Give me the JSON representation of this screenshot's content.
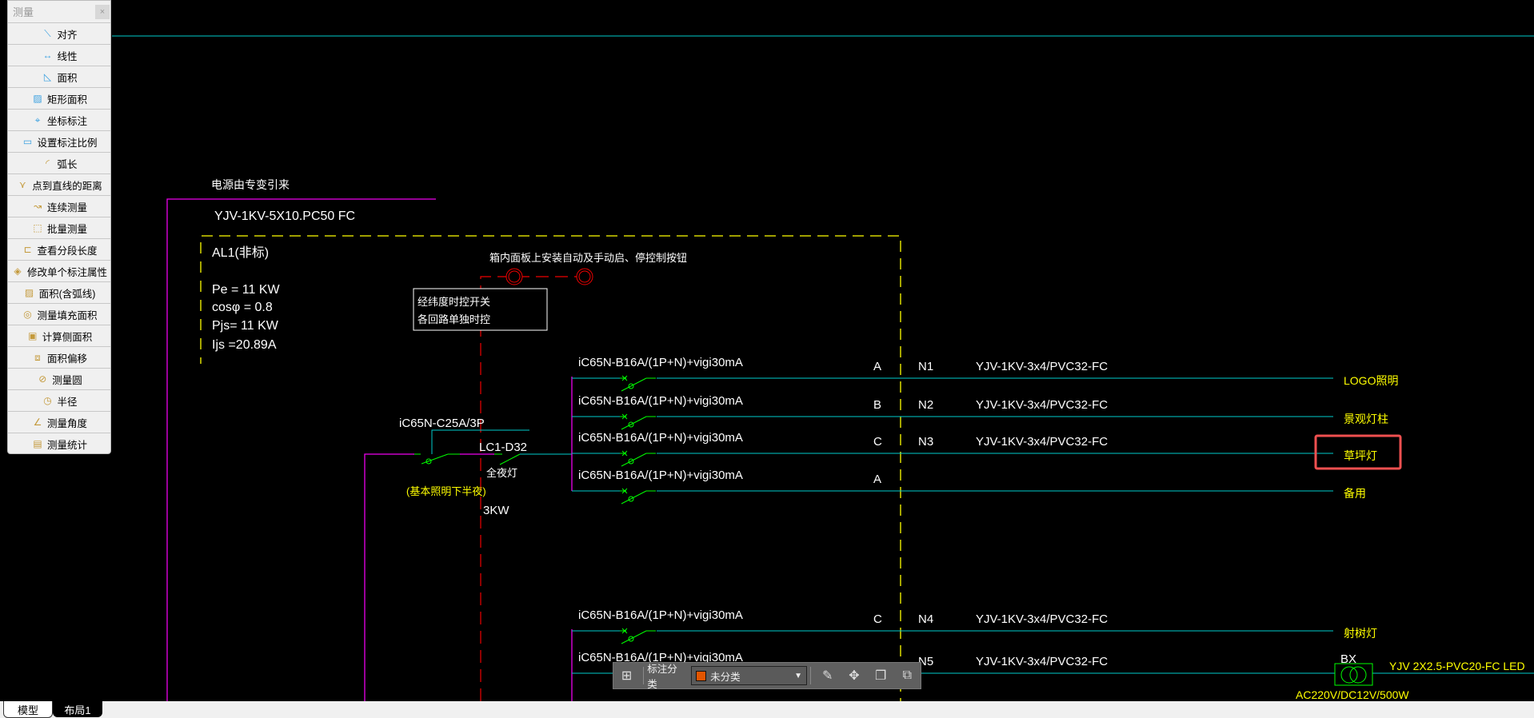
{
  "panel": {
    "title": "测量",
    "close_label": "×",
    "items": [
      {
        "label": "对齐",
        "icon": "aligned-dimension-icon"
      },
      {
        "label": "线性",
        "icon": "linear-dimension-icon"
      },
      {
        "label": "面积",
        "icon": "area-icon"
      },
      {
        "label": "矩形面积",
        "icon": "rect-area-icon"
      },
      {
        "label": "坐标标注",
        "icon": "coordinate-icon"
      },
      {
        "label": "设置标注比例",
        "icon": "scale-ruler-icon"
      },
      {
        "label": "弧长",
        "icon": "arc-length-icon"
      },
      {
        "label": "点到直线的距离",
        "icon": "point-line-distance-icon"
      },
      {
        "label": "连续测量",
        "icon": "continuous-measure-icon"
      },
      {
        "label": "批量测量",
        "icon": "batch-measure-icon"
      },
      {
        "label": "查看分段长度",
        "icon": "segment-length-icon"
      },
      {
        "label": "修改单个标注属性",
        "icon": "edit-dimension-icon"
      },
      {
        "label": "面积(含弧线)",
        "icon": "arc-area-icon"
      },
      {
        "label": "测量填充面积",
        "icon": "hatch-area-icon"
      },
      {
        "label": "计算侧面积",
        "icon": "side-area-icon"
      },
      {
        "label": "面积偏移",
        "icon": "area-offset-icon"
      },
      {
        "label": "测量圆",
        "icon": "circle-measure-icon"
      },
      {
        "label": "半径",
        "icon": "radius-icon"
      },
      {
        "label": "测量角度",
        "icon": "angle-icon"
      },
      {
        "label": "测量统计",
        "icon": "statistics-icon"
      }
    ]
  },
  "drawing": {
    "source_note": "电源由专变引来",
    "incoming_cable": "YJV-1KV-5X10.PC50  FC",
    "panel_name": "AL1(非标)",
    "pe": "Pe = 11  KW",
    "cos": "cosφ = 0.8",
    "pjs": "Pjs= 11  KW",
    "ijs": "Ijs =20.89A",
    "button_note": "箱内面板上安装自动及手动启、停控制按钮",
    "timer_line1": "经纬度时控开关",
    "timer_line2": "各回路单独时控",
    "main_breaker": "iC65N-C25A/3P",
    "contactor": "LC1-D32",
    "all_night": "全夜灯",
    "basic_note": "(基本照明下半夜)",
    "power": "3KW",
    "circuits": [
      {
        "breaker": "iC65N-B16A/(1P+N)+vigi30mA",
        "phase": "A",
        "no": "N1",
        "cable": "YJV-1KV-3x4/PVC32-FC",
        "load": "LOGO照明"
      },
      {
        "breaker": "iC65N-B16A/(1P+N)+vigi30mA",
        "phase": "B",
        "no": "N2",
        "cable": "YJV-1KV-3x4/PVC32-FC",
        "load": "景观灯柱"
      },
      {
        "breaker": "iC65N-B16A/(1P+N)+vigi30mA",
        "phase": "C",
        "no": "N3",
        "cable": "YJV-1KV-3x4/PVC32-FC",
        "load": "草坪灯"
      },
      {
        "breaker": "iC65N-B16A/(1P+N)+vigi30mA",
        "phase": "A",
        "no": "",
        "cable": "",
        "load": "备用"
      },
      {
        "breaker": "iC65N-B16A/(1P+N)+vigi30mA",
        "phase": "C",
        "no": "N4",
        "cable": "YJV-1KV-3x4/PVC32-FC",
        "load": "射树灯"
      },
      {
        "breaker": "iC65N-B16A/(1P+N)+vigi30mA",
        "phase": "",
        "no": "N5",
        "cable": "YJV-1KV-3x4/PVC32-FC",
        "load": ""
      }
    ],
    "transformer_label": "BX",
    "transformer_cable": "YJV 2X2.5-PVC20-FC LED",
    "transformer_rating": "AC220V/DC12V/500W",
    "highlight_color": "#f05050"
  },
  "toolbar": {
    "category_label": "标注分类",
    "category_value": "未分类",
    "swatch_color": "#e35500"
  },
  "tabs": [
    {
      "label": "模型"
    },
    {
      "label": "布局1"
    }
  ]
}
